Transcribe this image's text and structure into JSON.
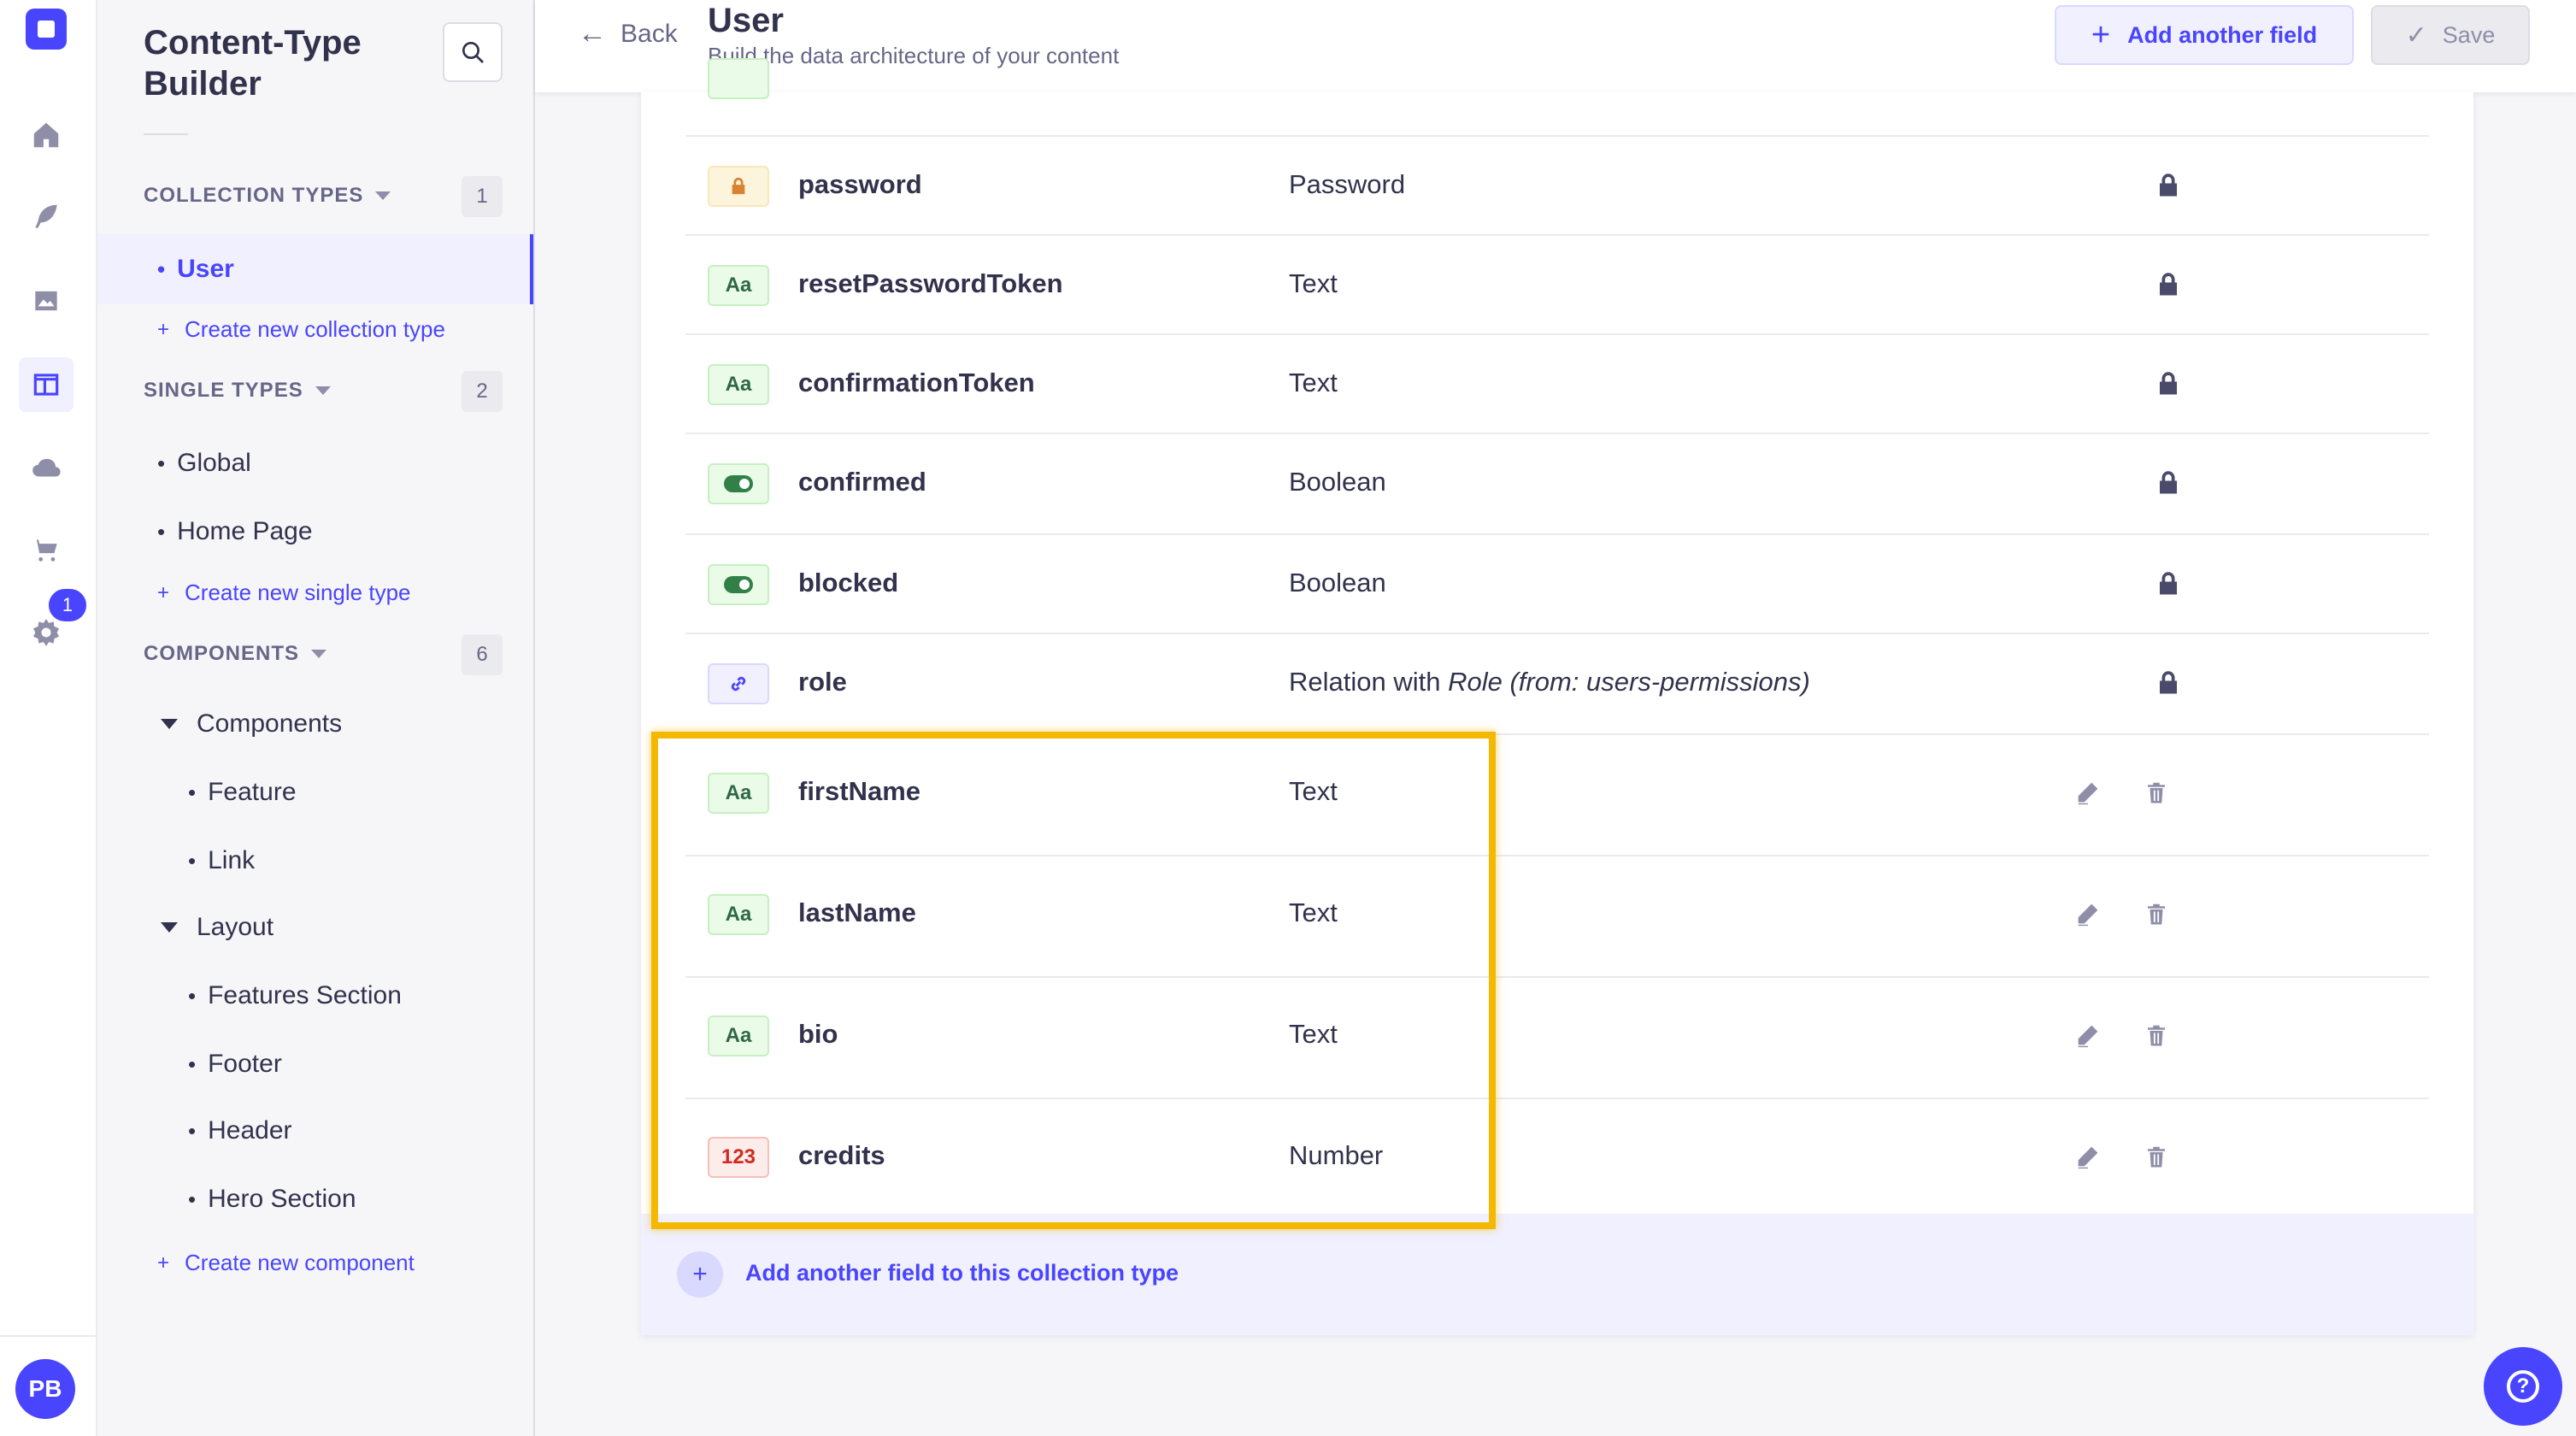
{
  "mainnav": {
    "notification_count": "1",
    "avatar_initials": "PB"
  },
  "subnav": {
    "title": "Content-Type Builder",
    "collection_types": {
      "label": "COLLECTION TYPES",
      "count": "1",
      "items": [
        "User"
      ],
      "create_label": "Create new collection type"
    },
    "single_types": {
      "label": "SINGLE TYPES",
      "count": "2",
      "items": [
        "Global",
        "Home Page"
      ],
      "create_label": "Create new single type"
    },
    "components": {
      "label": "COMPONENTS",
      "count": "6",
      "groups": [
        {
          "name": "Components",
          "items": [
            "Feature",
            "Link"
          ]
        },
        {
          "name": "Layout",
          "items": [
            "Features Section",
            "Footer",
            "Header",
            "Hero Section"
          ]
        }
      ],
      "create_label": "Create new component"
    }
  },
  "header": {
    "back_label": "Back",
    "title": "User",
    "subtitle": "Build the data architecture of your content",
    "add_field_label": "Add another field",
    "save_label": "Save"
  },
  "fields": [
    {
      "name": "password",
      "type": "Password",
      "icon": "lock-icon",
      "locked": true
    },
    {
      "name": "resetPasswordToken",
      "type": "Text",
      "icon": "text-icon",
      "locked": true
    },
    {
      "name": "confirmationToken",
      "type": "Text",
      "icon": "text-icon",
      "locked": true
    },
    {
      "name": "confirmed",
      "type": "Boolean",
      "icon": "toggle-icon",
      "locked": true
    },
    {
      "name": "blocked",
      "type": "Boolean",
      "icon": "toggle-icon",
      "locked": true
    },
    {
      "name": "role",
      "type_prefix": "Relation with ",
      "type_emph": "Role (from: users-permissions)",
      "icon": "link-icon",
      "locked": true
    },
    {
      "name": "firstName",
      "type": "Text",
      "icon": "text-icon",
      "locked": false
    },
    {
      "name": "lastName",
      "type": "Text",
      "icon": "text-icon",
      "locked": false
    },
    {
      "name": "bio",
      "type": "Text",
      "icon": "text-icon",
      "locked": false
    },
    {
      "name": "credits",
      "type": "Number",
      "icon": "number-icon",
      "locked": false
    }
  ],
  "icon_labels": {
    "text": "Aa",
    "number": "123"
  },
  "add_field_row_label": "Add another field to this collection type",
  "colors": {
    "primary": "#4945ff",
    "highlight": "#f5b800",
    "text_dark": "#32324d",
    "text_muted": "#666687"
  }
}
